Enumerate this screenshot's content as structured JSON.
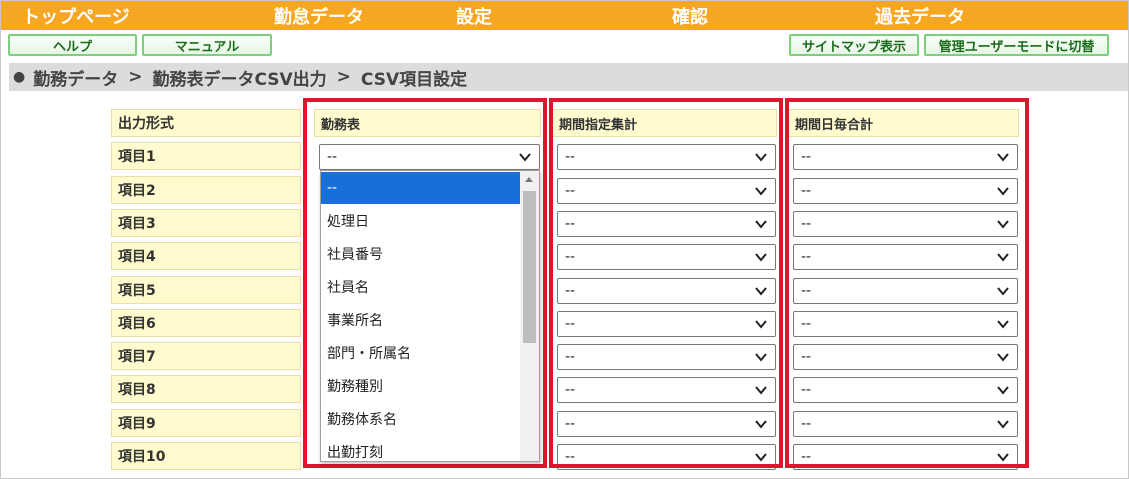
{
  "nav": {
    "items": [
      {
        "label": "トップページ"
      },
      {
        "label": "勤怠データ"
      },
      {
        "label": "設定"
      },
      {
        "label": "確認"
      },
      {
        "label": "過去データ"
      }
    ]
  },
  "toolbar": {
    "help_label": "ヘルプ",
    "manual_label": "マニュアル",
    "sitemap_label": "サイトマップ表示",
    "admin_label": "管理ユーザーモードに切替"
  },
  "breadcrumb": {
    "parts": [
      "勤務データ",
      "勤務表データCSV出力",
      "CSV項目設定"
    ],
    "separator": ">"
  },
  "table": {
    "header_label": "出力形式",
    "columns": [
      "勤務表",
      "期間指定集計",
      "期間日毎合計"
    ],
    "rows": [
      "項目1",
      "項目2",
      "項目3",
      "項目4",
      "項目5",
      "項目6",
      "項目7",
      "項目8",
      "項目9",
      "項目10"
    ],
    "select_value": "--"
  },
  "dropdown": {
    "options": [
      "--",
      "処理日",
      "社員番号",
      "社員名",
      "事業所名",
      "部門・所属名",
      "勤務種別",
      "勤務体系名",
      "出勤打刻"
    ],
    "selected": "--"
  },
  "colors": {
    "nav": "#f5a623",
    "highlight": "#e0142b",
    "label_bg": "#fffbcf",
    "selected_option": "#1a6ed8"
  }
}
